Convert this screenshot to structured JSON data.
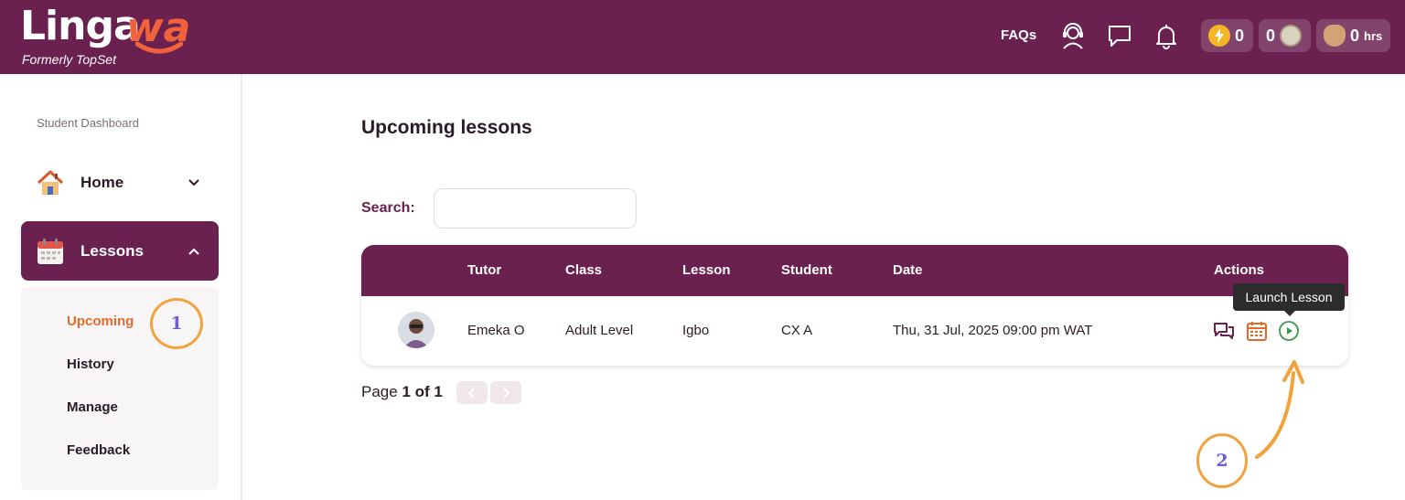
{
  "header": {
    "logo_text": "Linga",
    "logo_accent": "wa",
    "logo_subtitle": "Formerly TopSet",
    "faqs_label": "FAQs",
    "icons": [
      "support-headset-icon",
      "chat-icon",
      "bell-icon"
    ],
    "stats": [
      {
        "name": "energy",
        "value": "0",
        "icon": "lightning-coin-icon"
      },
      {
        "name": "tokens",
        "value": "0",
        "icon": "token-icon"
      },
      {
        "name": "hours",
        "value": "0",
        "unit": "hrs",
        "icon": "money-bag-icon"
      }
    ]
  },
  "sidebar": {
    "section_label": "Student Dashboard",
    "items": [
      {
        "label": "Home",
        "icon": "house-icon",
        "expanded": false
      },
      {
        "label": "Lessons",
        "icon": "calendar-icon",
        "expanded": true
      }
    ],
    "submenu": [
      {
        "label": "Upcoming",
        "active": true
      },
      {
        "label": "History",
        "active": false
      },
      {
        "label": "Manage",
        "active": false
      },
      {
        "label": "Feedback",
        "active": false
      }
    ]
  },
  "main": {
    "title": "Upcoming lessons",
    "search_label": "Search:",
    "search_value": "",
    "table": {
      "columns": [
        "Tutor",
        "Class",
        "Lesson",
        "Student",
        "Date",
        "Actions"
      ],
      "rows": [
        {
          "tutor": "Emeka O",
          "class": "Adult Level",
          "lesson": "Igbo",
          "student": "CX A",
          "date": "Thu, 31 Jul, 2025 09:00 pm WAT"
        }
      ]
    },
    "tooltip": "Launch Lesson",
    "pager": {
      "prefix": "Page ",
      "current": "1 of 1"
    }
  },
  "annotations": {
    "step1": "1",
    "step2": "2"
  },
  "colors": {
    "brand": "#6b2150",
    "accent": "#e36a2b",
    "annotation": "#f2a23a",
    "launch": "#3a9a4a"
  }
}
